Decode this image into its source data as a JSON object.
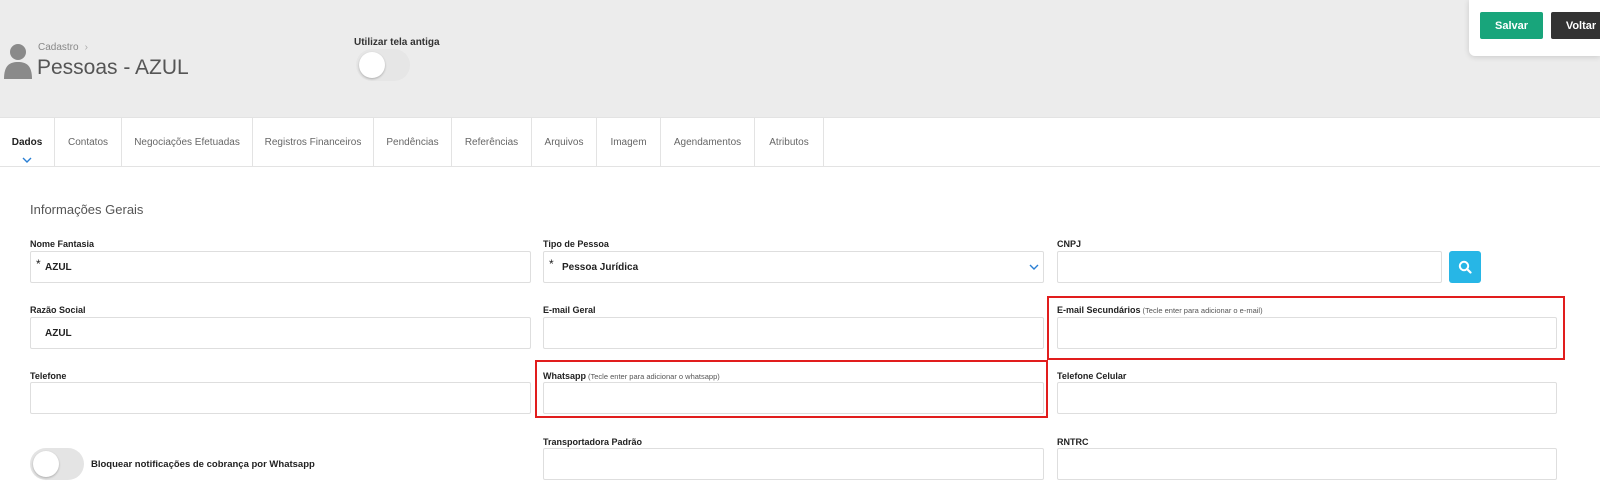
{
  "header": {
    "breadcrumb": "Cadastro",
    "breadcrumb_sep": "›",
    "title": "Pessoas - AZUL",
    "old_screen_label": "Utilizar tela antiga"
  },
  "actions": {
    "save": "Salvar",
    "back": "Voltar",
    "save_color": "#18a57b",
    "back_color": "#333333"
  },
  "tabs": [
    {
      "label": "Dados",
      "active": true
    },
    {
      "label": "Contatos"
    },
    {
      "label": "Negociações Efetuadas"
    },
    {
      "label": "Registros Financeiros"
    },
    {
      "label": "Pendências"
    },
    {
      "label": "Referências"
    },
    {
      "label": "Arquivos"
    },
    {
      "label": "Imagem"
    },
    {
      "label": "Agendamentos"
    },
    {
      "label": "Atributos"
    }
  ],
  "form": {
    "section_title": "Informações Gerais",
    "nome_fantasia": {
      "label": "Nome Fantasia",
      "value": "AZUL",
      "required": "*"
    },
    "tipo_pessoa": {
      "label": "Tipo de Pessoa",
      "value": "Pessoa Jurídica",
      "required": "*"
    },
    "cnpj": {
      "label": "CNPJ",
      "value": ""
    },
    "razao_social": {
      "label": "Razão Social",
      "value": "AZUL"
    },
    "email_geral": {
      "label": "E-mail Geral",
      "value": ""
    },
    "email_secundarios": {
      "label": "E-mail Secundários",
      "hint": "(Tecle enter para adicionar o e-mail)",
      "value": ""
    },
    "telefone": {
      "label": "Telefone",
      "value": ""
    },
    "whatsapp": {
      "label": "Whatsapp",
      "hint": "(Tecle enter para adicionar o whatsapp)",
      "value": ""
    },
    "telefone_celular": {
      "label": "Telefone Celular",
      "value": ""
    },
    "transportadora": {
      "label": "Transportadora Padrão",
      "value": ""
    },
    "rntrc": {
      "label": "RNTRC",
      "value": ""
    },
    "bloquear_toggle_label": "Bloquear notificações de cobrança por Whatsapp"
  },
  "icons": {
    "search": "search-icon",
    "avatar": "user-icon",
    "caret": "chevron-down-icon"
  },
  "highlight_color": "#e11d1d",
  "accent_color": "#27b6e6"
}
